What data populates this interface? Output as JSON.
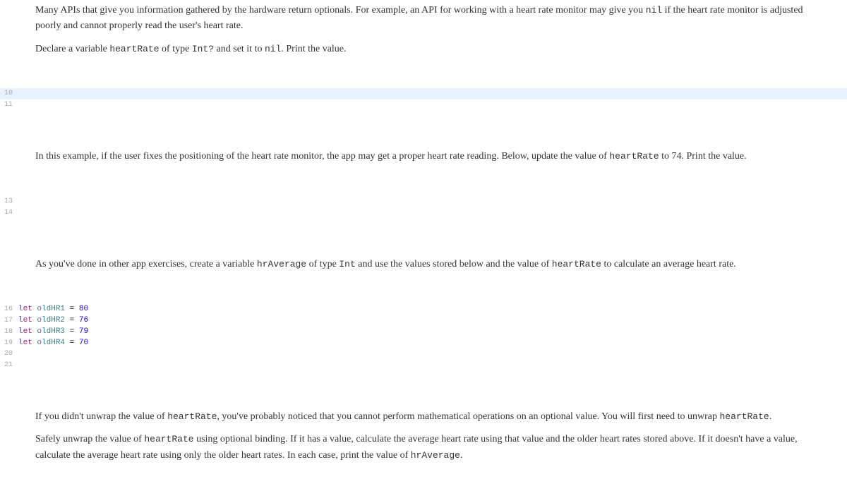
{
  "para1": {
    "t1": "Many APIs that give you information gathered by the hardware return optionals. For example, an API for working with a heart rate monitor may give you ",
    "c1": "nil",
    "t2": " if the heart rate monitor is adjusted poorly and cannot properly read the user's heart rate."
  },
  "para2": {
    "t1": "Declare a variable ",
    "c1": "heartRate",
    "t2": " of type ",
    "c2": "Int?",
    "t3": " and set it to ",
    "c3": "nil",
    "t4": ". Print the value."
  },
  "codeblock1": {
    "lines": [
      {
        "n": "10",
        "content": "",
        "hl": true
      },
      {
        "n": "11",
        "content": ""
      }
    ]
  },
  "para3": {
    "t1": "In this example, if the user fixes the positioning of the heart rate monitor, the app may get a proper heart rate reading. Below, update the value of ",
    "c1": "heartRate",
    "t2": " to 74. Print the value."
  },
  "codeblock2": {
    "lines": [
      {
        "n": "13",
        "content": ""
      },
      {
        "n": "14",
        "content": ""
      }
    ]
  },
  "para4": {
    "t1": "As you've done in other app exercises, create a variable ",
    "c1": "hrAverage",
    "t2": " of type ",
    "c2": "Int",
    "t3": " and use the values stored below and the value of ",
    "c3": "heartRate",
    "t4": " to calculate an average heart rate."
  },
  "codeblock3": {
    "lines": [
      {
        "n": "16",
        "kw": "let",
        "id": "oldHR1",
        "eq": " = ",
        "num": "80"
      },
      {
        "n": "17",
        "kw": "let",
        "id": "oldHR2",
        "eq": " = ",
        "num": "76"
      },
      {
        "n": "18",
        "kw": "let",
        "id": "oldHR3",
        "eq": " = ",
        "num": "79"
      },
      {
        "n": "19",
        "kw": "let",
        "id": "oldHR4",
        "eq": " = ",
        "num": "70"
      },
      {
        "n": "20",
        "content": ""
      },
      {
        "n": "21",
        "content": ""
      }
    ]
  },
  "para5": {
    "t1": "If you didn't unwrap the value of ",
    "c1": "heartRate",
    "t2": ", you've probably noticed that you cannot perform mathematical operations on an optional value. You will first need to unwrap ",
    "c2": "heartRate",
    "t3": "."
  },
  "para6": {
    "t1": "Safely unwrap the value of ",
    "c1": "heartRate",
    "t2": " using optional binding. If it has a value, calculate the average heart rate using that value and the older heart rates stored above. If it doesn't have a value, calculate the average heart rate using only the older heart rates. In each case, print the value of ",
    "c2": "hrAverage",
    "t3": "."
  }
}
